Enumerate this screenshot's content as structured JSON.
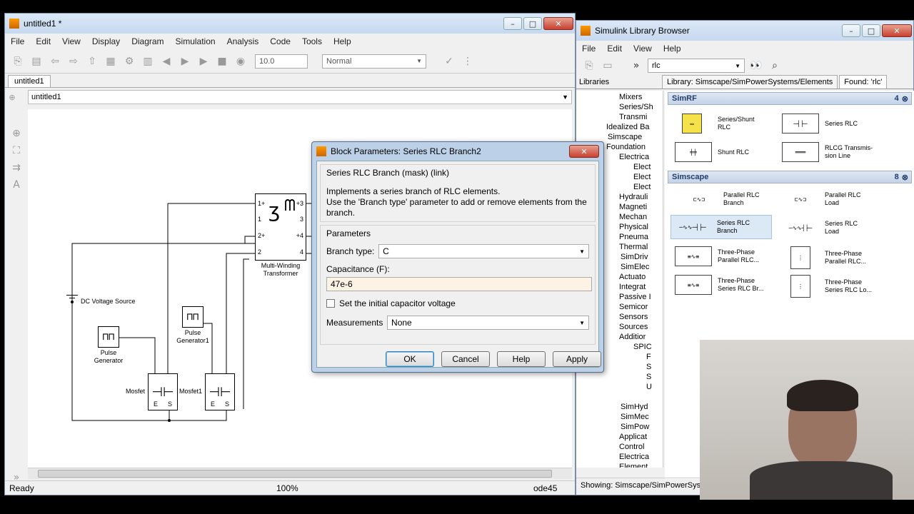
{
  "simulink": {
    "title": "untitled1 *",
    "menus": [
      "File",
      "Edit",
      "View",
      "Display",
      "Diagram",
      "Simulation",
      "Analysis",
      "Code",
      "Tools",
      "Help"
    ],
    "stop_time": "10.0",
    "sim_mode": "Normal",
    "tab": "untitled1",
    "breadcrumb": "untitled1",
    "status_left": "Ready",
    "status_zoom": "100%",
    "status_solver": "ode45",
    "blocks": {
      "transformer": "Multi-Winding\nTransformer",
      "dc_source": "DC Voltage Source",
      "pulse1": "Pulse\nGenerator",
      "pulse2": "Pulse\nGenerator1",
      "mosfet": "Mosfet",
      "mosfet1": "Mosfet1",
      "port_1p": "1+",
      "port_1": "1",
      "port_2p": "2+",
      "port_2": "2",
      "port_3p": "+3",
      "port_3": "3",
      "port_4p": "+4",
      "port_4": "4",
      "gnd_e": "E",
      "gnd_s": "S"
    }
  },
  "dialog": {
    "title": "Block Parameters: Series RLC Branch2",
    "group_title": "Series RLC Branch (mask) (link)",
    "description": "Implements a series branch of RLC elements.\nUse the 'Branch type' parameter to add or remove elements from the branch.",
    "params_title": "Parameters",
    "branch_type_label": "Branch type:",
    "branch_type_value": "C",
    "capacitance_label": "Capacitance (F):",
    "capacitance_value": "47e-6",
    "checkbox_label": "Set the initial capacitor voltage",
    "measurements_label": "Measurements",
    "measurements_value": "None",
    "ok": "OK",
    "cancel": "Cancel",
    "help": "Help",
    "apply": "Apply"
  },
  "library": {
    "title": "Simulink Library Browser",
    "menus": [
      "File",
      "Edit",
      "View",
      "Help"
    ],
    "search_value": "rlc",
    "libraries_tab": "Libraries",
    "path_tab": "Library: Simscape/SimPowerSystems/Elements",
    "found_tab": "Found: 'rlc'",
    "tree": [
      "Mixers",
      "Series/Sh",
      "Transmi",
      "Idealized Ba",
      "Simscape",
      "Foundation",
      "Electrica",
      "Elect",
      "Elect",
      "Elect",
      "Hydrauli",
      "Magneti",
      "Mechan",
      "Physical",
      "Pneuma",
      "Thermal",
      "SimDriv",
      "SimElec",
      "Actuato",
      "Integrat",
      "Passive I",
      "Semicor",
      "Sensors",
      "Sources",
      "Additior",
      "SPIC",
      "F",
      "S",
      "S",
      "U",
      "",
      "",
      "SimHyd",
      "SimMec",
      "SimPow",
      "Applicat",
      "Control",
      "Electrica",
      "Element"
    ],
    "group1": {
      "name": "SimRF",
      "count": "4"
    },
    "group1_items": [
      "Series/Shunt\nRLC",
      "Series RLC",
      "Shunt RLC",
      "RLCG Transmis-\nsion Line"
    ],
    "group2": {
      "name": "Simscape",
      "count": "8"
    },
    "group2_items": [
      "Parallel RLC\nBranch",
      "Parallel RLC\nLoad",
      "Series RLC\nBranch",
      "Series RLC\nLoad",
      "Three-Phase\nParallel RLC...",
      "Three-Phase\nParallel RLC...",
      "Three-Phase\nSeries RLC Br...",
      "Three-Phase\nSeries RLC Lo..."
    ],
    "status": "Showing: Simscape/SimPowerSyste"
  }
}
